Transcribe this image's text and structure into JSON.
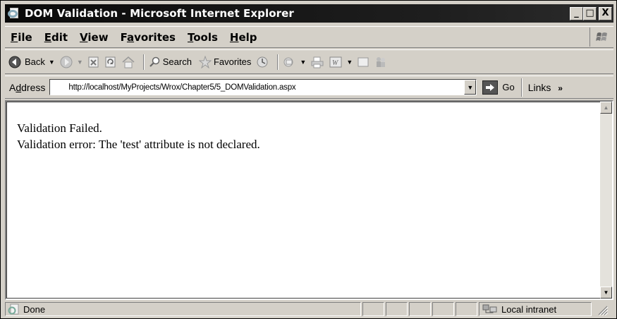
{
  "window": {
    "title": "DOM Validation - Microsoft Internet Explorer",
    "buttons": {
      "minimize": "_",
      "maximize": "□",
      "close": "X"
    }
  },
  "menubar": {
    "file": {
      "underline": "F",
      "rest": "ile"
    },
    "edit": {
      "underline": "E",
      "rest": "dit"
    },
    "view": {
      "underline": "V",
      "rest": "iew"
    },
    "favorites": {
      "before": "F",
      "underline": "a",
      "rest": "vorites"
    },
    "tools": {
      "underline": "T",
      "rest": "ools"
    },
    "help": {
      "underline": "H",
      "rest": "elp"
    }
  },
  "toolbar": {
    "back_label": "Back",
    "search_label": "Search",
    "favorites_label": "Favorites"
  },
  "addressbar": {
    "label_before": "A",
    "label_underline": "d",
    "label_after": "dress",
    "url": "http://localhost/MyProjects/Wrox/Chapter5/5_DOMValidation.aspx",
    "go_label": "Go",
    "links_label": "Links",
    "links_chevron": "»"
  },
  "content": {
    "line1": "Validation Failed.",
    "line2": "Validation error: The 'test' attribute is not declared."
  },
  "statusbar": {
    "status_text": "Done",
    "zone_text": "Local intranet"
  }
}
